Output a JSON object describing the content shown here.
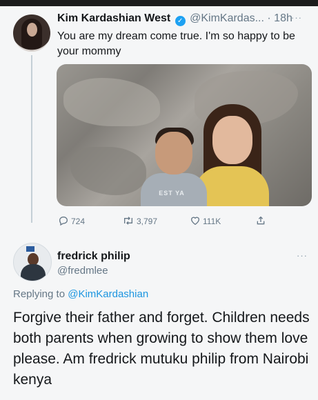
{
  "tweet": {
    "author_name": "Kim Kardashian West",
    "author_handle": "@KimKardas...",
    "separator": "·",
    "time": "18h",
    "more": "···",
    "text": "You are my dream come true. I'm so happy to be your mommy",
    "photo_shirt_text": "EST YA",
    "actions": {
      "replies": "724",
      "retweets": "3,797",
      "likes": "111K"
    }
  },
  "reply": {
    "author_name": "fredrick philip",
    "author_handle": "@fredmlee",
    "more": "···",
    "replying_prefix": "Replying to",
    "replying_to": "@KimKardashian",
    "text": "Forgive their father and forget. Children needs both parents when growing to show them love please. Am fredrick mutuku philip from Nairobi kenya"
  },
  "icons": {
    "verified": "verified-badge-icon",
    "reply": "reply-icon",
    "retweet": "retweet-icon",
    "like": "heart-icon",
    "share": "share-icon"
  },
  "colors": {
    "accent": "#1da1f2",
    "mention": "#1b95e0",
    "muted": "#657786",
    "background": "#f5f6f7"
  }
}
